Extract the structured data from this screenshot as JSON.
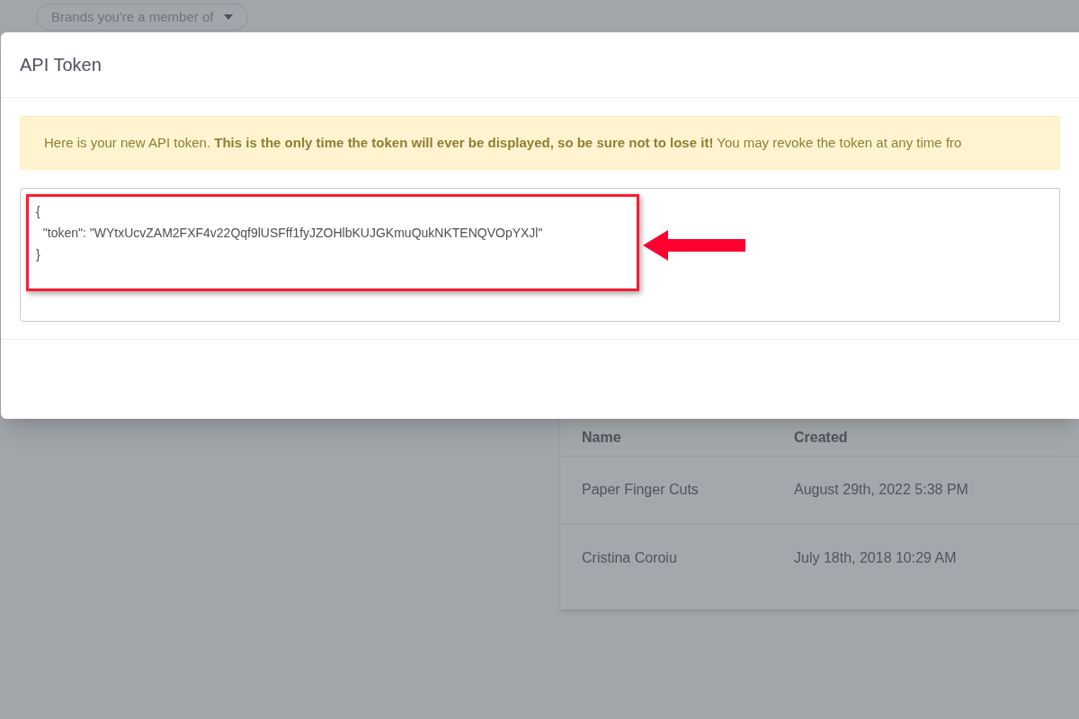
{
  "brand_dropdown": {
    "label": "Brands you're a member of"
  },
  "modal": {
    "title": "API Token",
    "alert": "Here is your new API token. **This is the only time the token will ever be displayed, so be sure not to lose it!** You may revoke the token at any time fro",
    "token_lines": [
      "{",
      "  \"token\": \"WYtxUcvZAM2FXF4v22Qqf9lUSFff1fyJZOHlbKUJGKmuQukNKTENQVOpYXJl\"",
      "}"
    ],
    "highlighted": true
  },
  "table": {
    "columns": [
      "Name",
      "Created"
    ],
    "rows": [
      [
        "Paper Finger Cuts",
        "August 29th, 2022 5:38 PM"
      ],
      [
        "Cristina Coroiu",
        "July 18th, 2018 10:29 AM"
      ]
    ]
  }
}
